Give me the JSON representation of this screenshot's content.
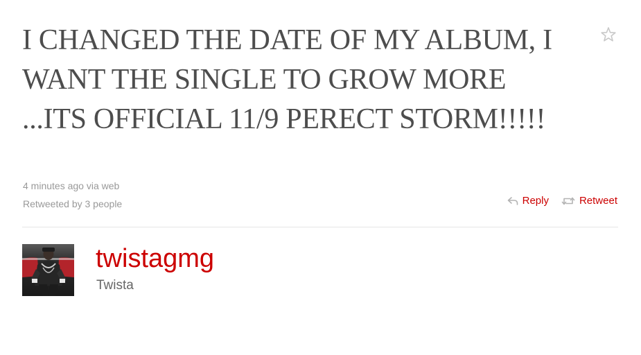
{
  "tweet": {
    "text": "I CHANGED THE DATE OF MY ALBUM, I WANT THE SINGLE TO GROW MORE ...ITS OFFICIAL 11/9 PERECT STORM!!!!!",
    "timestamp": "4 minutes ago",
    "via_prefix": "via",
    "via_source": "web",
    "retweeted_by": "Retweeted by 3 people"
  },
  "actions": {
    "reply_label": "Reply",
    "retweet_label": "Retweet",
    "favorite_icon": "star-icon",
    "reply_icon": "reply-arrow-icon",
    "retweet_icon": "retweet-icon"
  },
  "author": {
    "username": "twistagmg",
    "display_name": "Twista",
    "avatar_icon": "avatar-photo"
  },
  "colors": {
    "tweet_text": "#4d4d4d",
    "meta_text": "#999999",
    "link_red": "#cc0000",
    "divider": "#e6e6e6",
    "star_outline": "#cccccc"
  }
}
